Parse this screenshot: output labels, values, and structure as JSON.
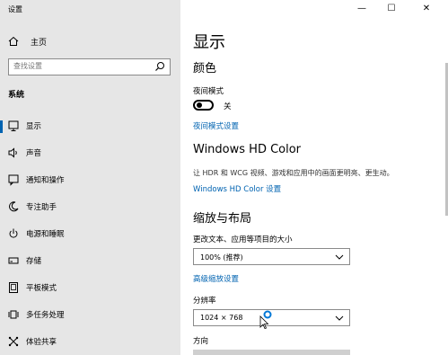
{
  "window": {
    "title": "设置",
    "minimize_glyph": "—",
    "maximize_glyph": "☐",
    "close_glyph": "✕"
  },
  "sidebar": {
    "home_label": "主页",
    "search_placeholder": "查找设置",
    "section_label": "系统",
    "items": [
      {
        "label": "显示",
        "icon": "display-icon",
        "selected": true
      },
      {
        "label": "声音",
        "icon": "speaker-icon"
      },
      {
        "label": "通知和操作",
        "icon": "notification-icon"
      },
      {
        "label": "专注助手",
        "icon": "moon-icon"
      },
      {
        "label": "电源和睡眠",
        "icon": "power-icon"
      },
      {
        "label": "存储",
        "icon": "storage-icon"
      },
      {
        "label": "平板模式",
        "icon": "tablet-icon"
      },
      {
        "label": "多任务处理",
        "icon": "multitask-icon"
      },
      {
        "label": "体验共享",
        "icon": "share-icon"
      }
    ]
  },
  "main": {
    "page_title": "显示",
    "color_heading": "颜色",
    "night_mode_label": "夜间模式",
    "night_mode_state": "关",
    "night_mode_link": "夜间模式设置",
    "hd_heading": "Windows HD Color",
    "hd_description": "让 HDR 和 WCG 视频、游戏和应用中的画面更明亮、更生动。",
    "hd_link": "Windows HD Color 设置",
    "scale_heading": "缩放与布局",
    "scale_label": "更改文本、应用等项目的大小",
    "scale_value": "100% (推荐)",
    "advanced_scale_link": "高级缩放设置",
    "resolution_label": "分辨率",
    "resolution_value": "1024 × 768",
    "orientation_label": "方向"
  },
  "colors": {
    "accent": "#0063b1",
    "sidebar_bg": "#e6e6e6"
  }
}
